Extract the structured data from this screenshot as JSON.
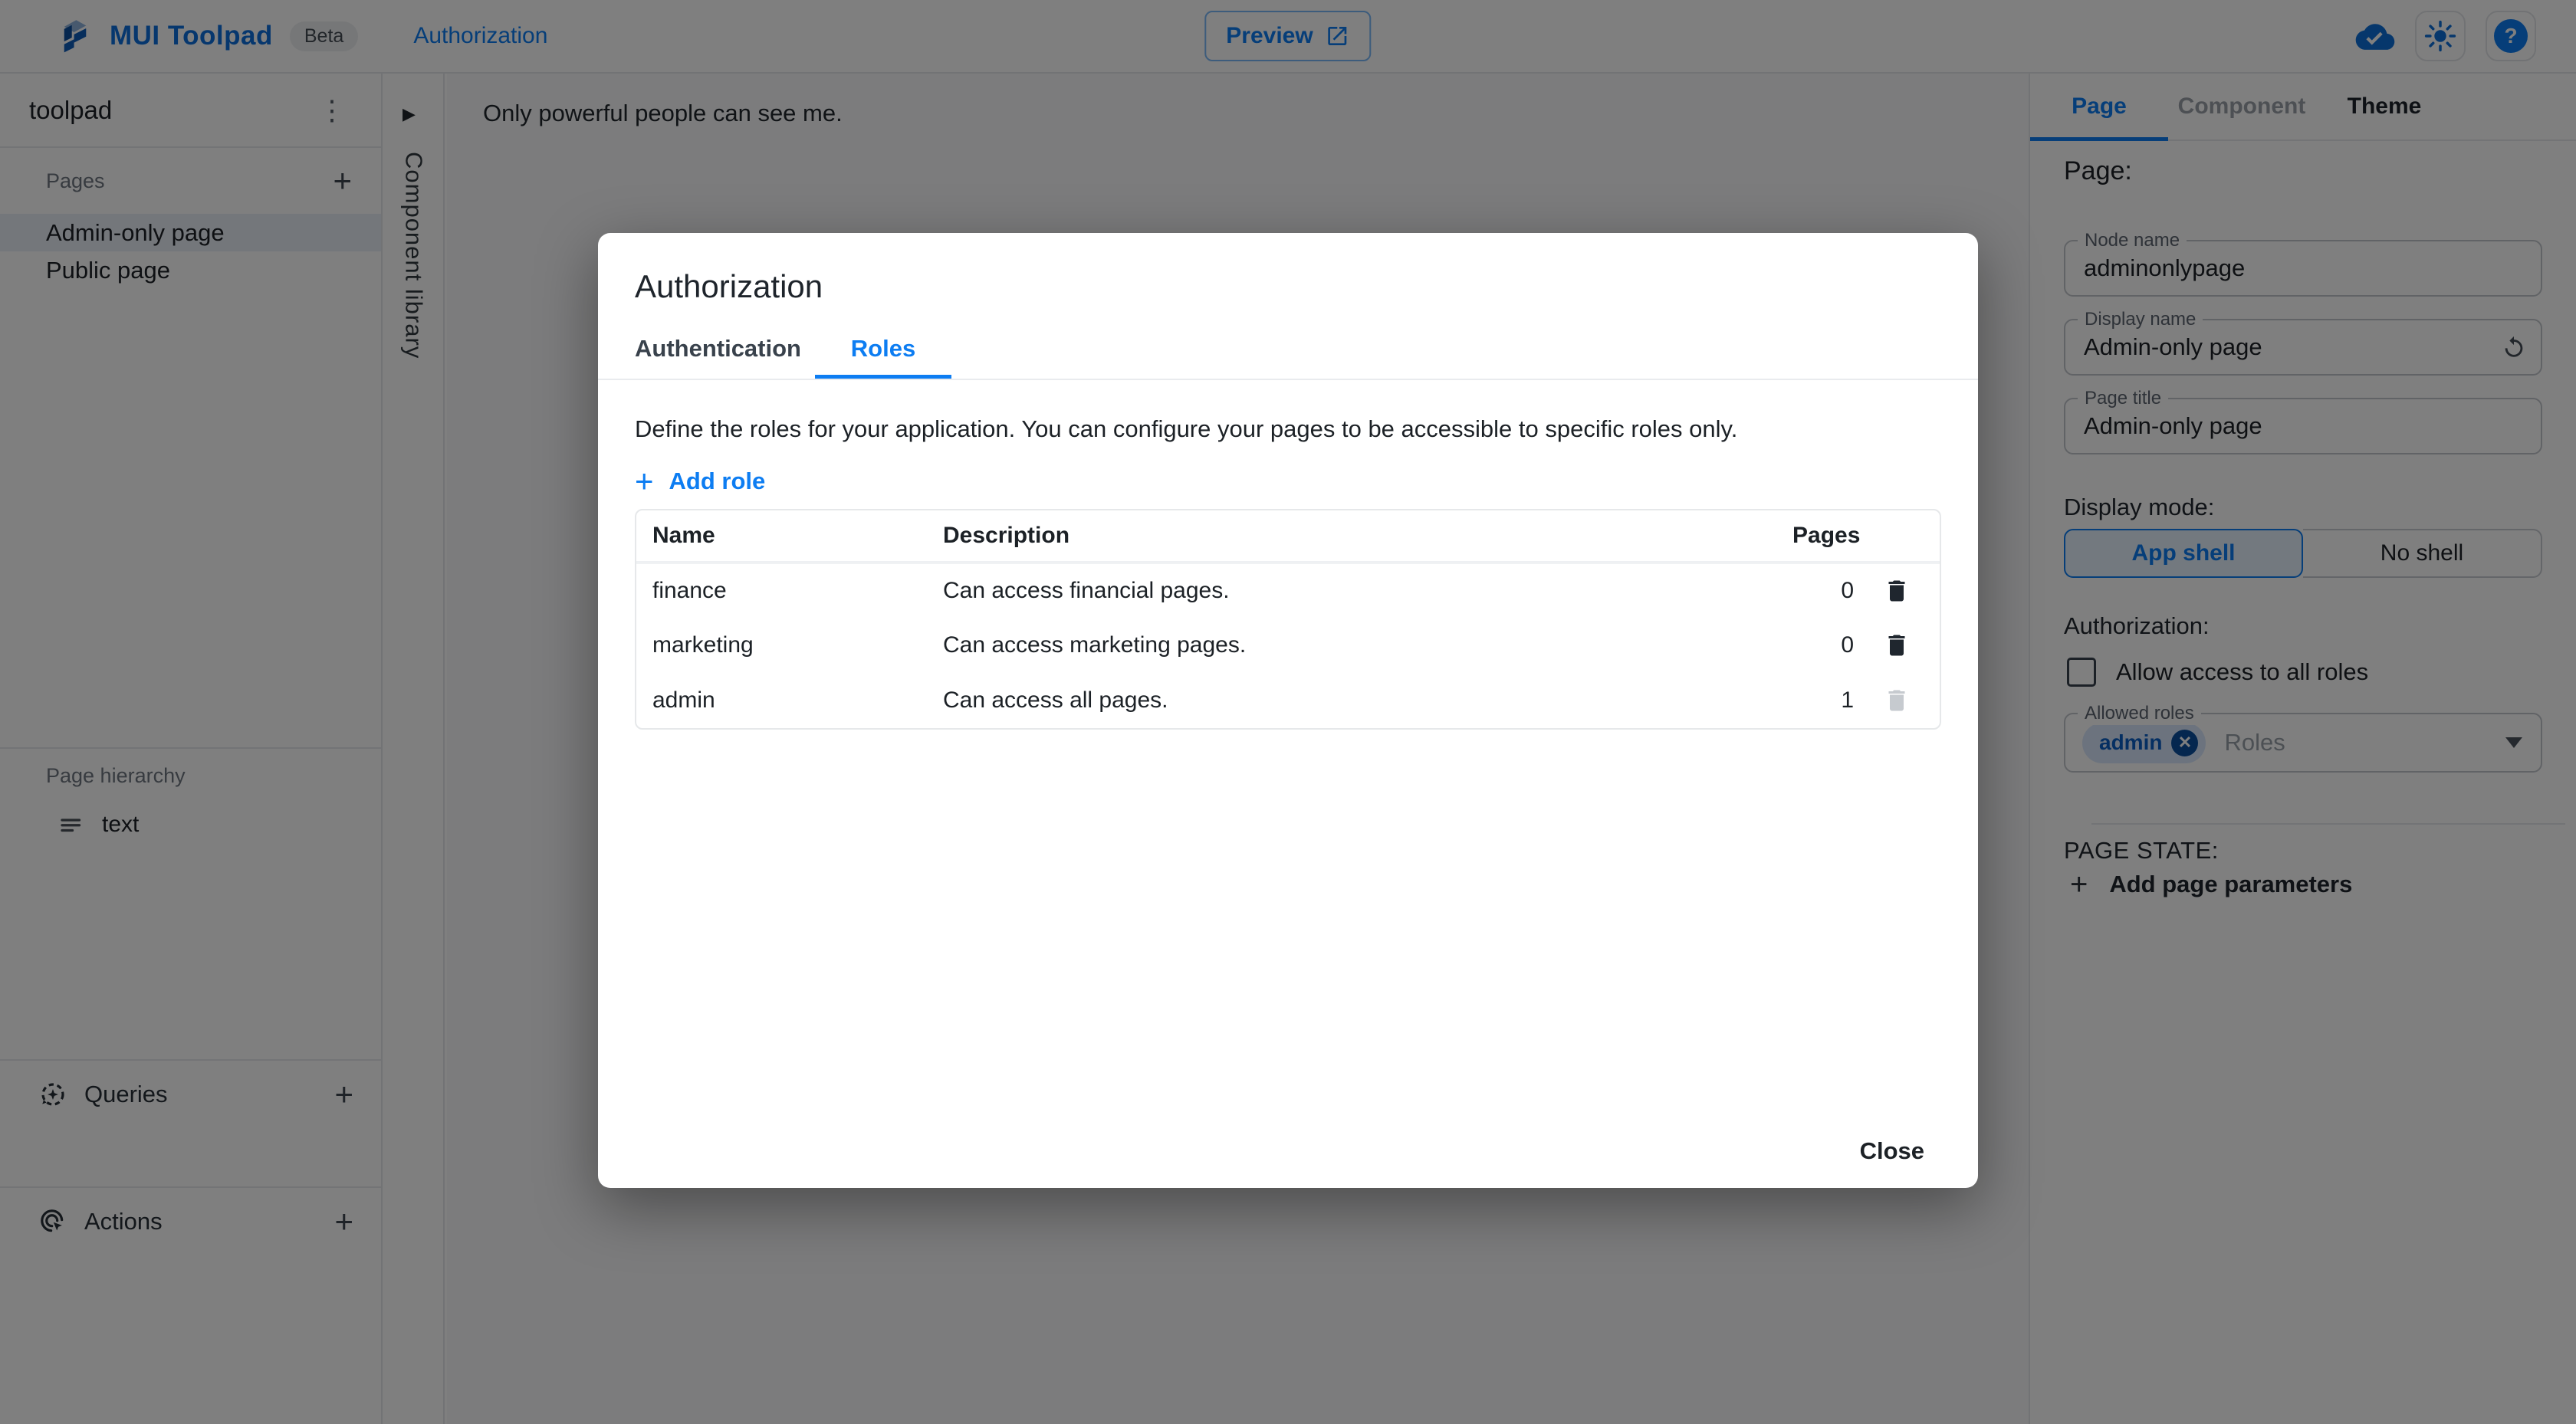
{
  "topbar": {
    "logo_text": "MUI Toolpad",
    "beta_label": "Beta",
    "breadcrumb": "Authorization",
    "preview_label": "Preview"
  },
  "sidebar": {
    "app_name": "toolpad",
    "pages_header": "Pages",
    "pages": [
      {
        "label": "Admin-only page"
      },
      {
        "label": "Public page"
      }
    ],
    "hierarchy_header": "Page hierarchy",
    "hierarchy_items": [
      {
        "label": "text"
      }
    ],
    "queries_label": "Queries",
    "actions_label": "Actions"
  },
  "component_library": {
    "label": "Component library"
  },
  "canvas": {
    "text": "Only powerful people can see me."
  },
  "modal": {
    "title": "Authorization",
    "tabs": [
      {
        "label": "Authentication"
      },
      {
        "label": "Roles"
      }
    ],
    "description": "Define the roles for your application. You can configure your pages to be accessible to specific roles only.",
    "add_role_label": "Add role",
    "table": {
      "headers": {
        "name": "Name",
        "description": "Description",
        "pages": "Pages"
      },
      "rows": [
        {
          "name": "finance",
          "description": "Can access financial pages.",
          "pages": "0"
        },
        {
          "name": "marketing",
          "description": "Can access marketing pages.",
          "pages": "0"
        },
        {
          "name": "admin",
          "description": "Can access all pages.",
          "pages": "1"
        }
      ]
    },
    "close_label": "Close"
  },
  "inspector": {
    "tabs": [
      {
        "label": "Page"
      },
      {
        "label": "Component"
      },
      {
        "label": "Theme"
      }
    ],
    "heading": "Page:",
    "fields": [
      {
        "label": "Node name",
        "value": "adminonlypage"
      },
      {
        "label": "Display name",
        "value": "Admin-only page"
      },
      {
        "label": "Page title",
        "value": "Admin-only page"
      }
    ],
    "display_mode_label": "Display mode:",
    "display_mode_options": [
      {
        "label": "App shell"
      },
      {
        "label": "No shell"
      }
    ],
    "authorization_label": "Authorization:",
    "allow_all_label": "Allow access to all roles",
    "allowed_roles_label": "Allowed roles",
    "allowed_roles_chips": [
      "admin"
    ],
    "allowed_roles_placeholder": "Roles",
    "page_state_label": "PAGE STATE:",
    "add_page_parameters_label": "Add page parameters"
  },
  "colors": {
    "primary": "#0d7df2",
    "logo_blue": "#0c6fdd",
    "text_primary": "#1c2126",
    "text_secondary": "#6f7680",
    "selected_page_bg": "#e9eef7",
    "chip_bg": "#d8e7fc",
    "overlay": "rgba(0,0,0,0.5)"
  }
}
